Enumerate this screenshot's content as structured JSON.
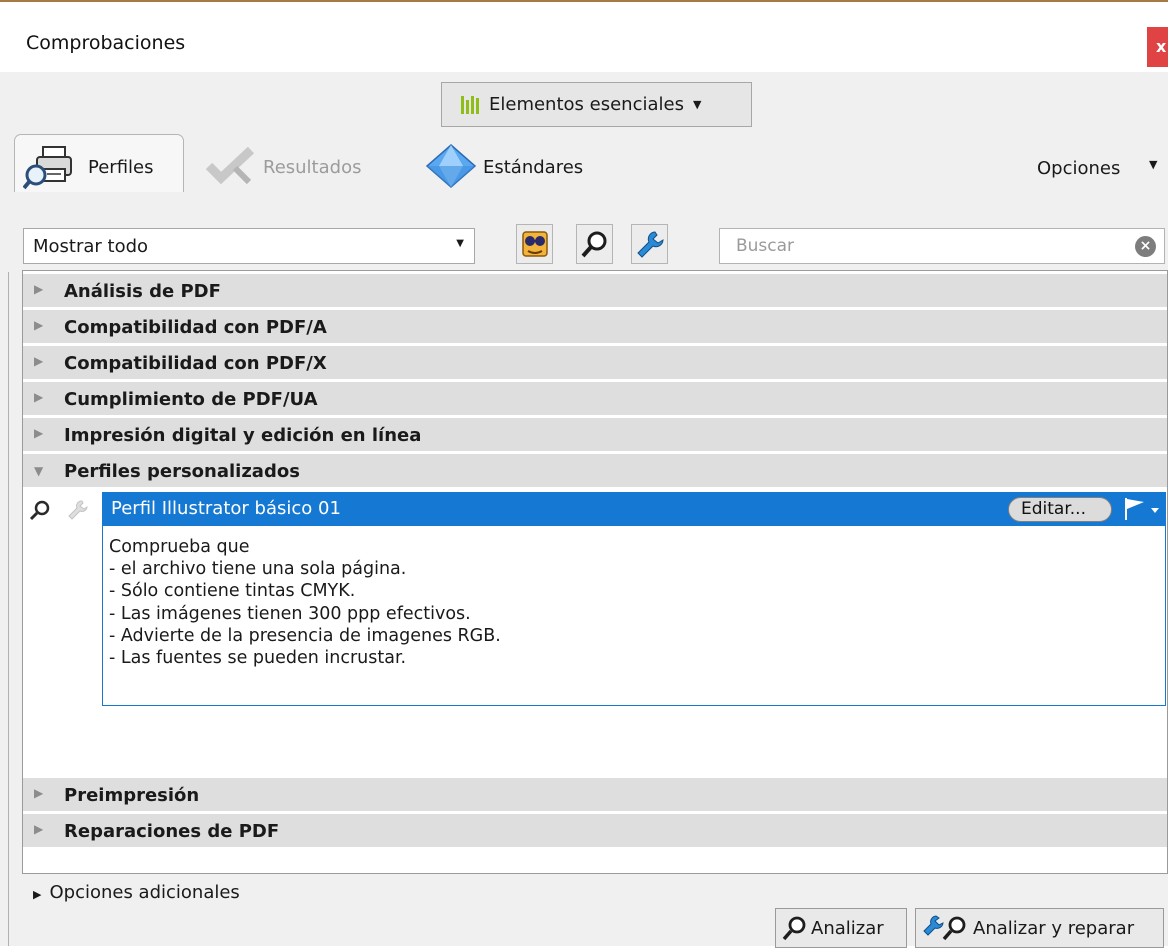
{
  "window": {
    "title": "Comprobaciones",
    "close_label": "x"
  },
  "workspace": {
    "label": "Elementos esenciales"
  },
  "tabs": [
    {
      "label": "Perfiles",
      "state": "active"
    },
    {
      "label": "Resultados",
      "state": "disabled"
    },
    {
      "label": "Estándares",
      "state": "normal"
    }
  ],
  "options_menu": {
    "label": "Opciones"
  },
  "filter": {
    "value": "Mostrar todo"
  },
  "search": {
    "placeholder": "Buscar"
  },
  "tree": {
    "categories": [
      {
        "label": "Análisis de PDF"
      },
      {
        "label": "Compatibilidad con PDF/A"
      },
      {
        "label": "Compatibilidad con PDF/X"
      },
      {
        "label": "Cumplimiento de PDF/UA"
      },
      {
        "label": "Impresión digital y edición en línea"
      },
      {
        "label": "Perfiles personalizados",
        "expanded": true
      },
      {
        "label": "Preimpresión"
      },
      {
        "label": "Reparaciones de PDF"
      }
    ],
    "selected_profile": {
      "name": "Perfil Illustrator básico 01",
      "edit_label": "Editar...",
      "description": [
        "Comprueba que",
        "- el archivo tiene una sola página.",
        "- Sólo contiene tintas CMYK.",
        "- Las imágenes tienen 300 ppp efectivos.",
        "- Advierte de la presencia de imagenes RGB.",
        "- Las fuentes se pueden incrustar."
      ]
    }
  },
  "footer": {
    "more_options": "Opciones adicionales",
    "analyze": "Analizar",
    "analyze_fix": "Analizar y reparar"
  },
  "icons": {
    "workspace": "bars-chart-icon",
    "perfiles_tab": "printer-magnifier-icon",
    "resultados_tab": "checkmark-wrench-icon",
    "estandares_tab": "diamond-icon",
    "tool_profile": "profile-glasses-icon",
    "tool_analyze": "magnifier-icon",
    "tool_fix": "wrench-icon",
    "flag": "flag-icon"
  },
  "colors": {
    "selection": "#1579d4",
    "close": "#e04343",
    "category_bg": "#dedede",
    "panel_bg": "#f0f0f0"
  }
}
